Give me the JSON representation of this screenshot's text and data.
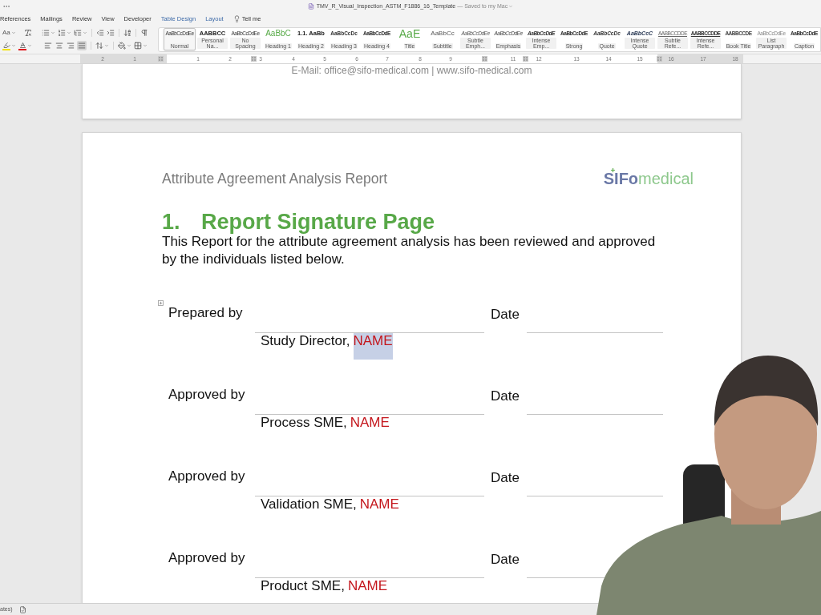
{
  "title_bar": {
    "title": "TMV_R_Visual_Inspection_ASTM_F1886_16_Template",
    "save_status": "— Saved to my Mac"
  },
  "menu": {
    "tabs": [
      {
        "label": "References",
        "kind": "standard"
      },
      {
        "label": "Mailings",
        "kind": "standard"
      },
      {
        "label": "Review",
        "kind": "standard"
      },
      {
        "label": "View",
        "kind": "standard"
      },
      {
        "label": "Developer",
        "kind": "standard"
      },
      {
        "label": "Table Design",
        "kind": "contextual"
      },
      {
        "label": "Layout",
        "kind": "contextual"
      }
    ],
    "tell_me": "Tell me"
  },
  "ribbon": {
    "change_case": "Aa",
    "alignment": [
      {
        "kind": "left",
        "selected": false
      },
      {
        "kind": "center",
        "selected": false
      },
      {
        "kind": "right",
        "selected": false
      },
      {
        "kind": "justify",
        "selected": true
      }
    ],
    "styles": [
      {
        "preview": "AaBbCcDdEe",
        "label": "Normal",
        "kind": "normal",
        "selected": true
      },
      {
        "preview": "AABBCC",
        "label": "Personal Na...",
        "kind": "personal",
        "selected": false
      },
      {
        "preview": "AaBbCcDdEe",
        "label": "No Spacing",
        "kind": "nospacing",
        "selected": false
      },
      {
        "preview": "AaBbC",
        "label": "Heading 1",
        "kind": "heading1",
        "selected": false
      },
      {
        "preview": "1.1. AaBb",
        "label": "Heading 2",
        "kind": "heading2",
        "selected": false
      },
      {
        "preview": "AaBbCcDc",
        "label": "Heading 3",
        "kind": "heading3",
        "selected": false
      },
      {
        "preview": "AaBbCcDdE",
        "label": "Heading 4",
        "kind": "heading4",
        "selected": false
      },
      {
        "preview": "AaE",
        "label": "Title",
        "kind": "title",
        "selected": false
      },
      {
        "preview": "AaBbCc",
        "label": "Subtitle",
        "kind": "subtitle",
        "selected": false
      },
      {
        "preview": "AaBbCcDdEe",
        "label": "Subtle Emph...",
        "kind": "subtleemphasis",
        "selected": false
      },
      {
        "preview": "AaBbCcDdEe",
        "label": "Emphasis",
        "kind": "emphasis",
        "selected": false
      },
      {
        "preview": "AaBbCcDdE",
        "label": "Intense Emp...",
        "kind": "intenseemphasis",
        "selected": false
      },
      {
        "preview": "AaBbCcDdE",
        "label": "Strong",
        "kind": "strong",
        "selected": false
      },
      {
        "preview": "AaBbCcDc",
        "label": "Quote",
        "kind": "quote",
        "selected": false
      },
      {
        "preview": "AaBbCcC",
        "label": "Intense Quote",
        "kind": "intensequote",
        "selected": false
      },
      {
        "preview": "AABBCCDDE",
        "label": "Subtle Refe...",
        "kind": "subtlereference",
        "selected": false
      },
      {
        "preview": "AABBCCDDE",
        "label": "Intense Refe...",
        "kind": "intensereference",
        "selected": false
      },
      {
        "preview": "AABBCCDE",
        "label": "Book Title",
        "kind": "booktitle",
        "selected": false
      },
      {
        "preview": "AaBbCcDdEe",
        "label": "List Paragraph",
        "kind": "listparagraph",
        "selected": false
      },
      {
        "preview": "AaBbCcDdE",
        "label": "Caption",
        "kind": "caption",
        "selected": false
      }
    ]
  },
  "ruler": {
    "labels": [
      "2",
      "1",
      "1",
      "2",
      "3",
      "4",
      "5",
      "6",
      "7",
      "8",
      "9",
      "11",
      "12",
      "13",
      "14",
      "15",
      "16",
      "17",
      "18"
    ]
  },
  "document": {
    "previous_page_footer": "E-Mail: office@sifo-medical.com | www.sifo-medical.com",
    "header_title": "Attribute Agreement Analysis Report",
    "logo": {
      "primary": "SIFo",
      "secondary": "medical"
    },
    "heading": {
      "number": "1.",
      "text": "Report Signature Page"
    },
    "intro": "This Report for the attribute agreement analysis has been reviewed and approved by the individuals listed below.",
    "signatures": [
      {
        "label": "Prepared by",
        "date_label": "Date",
        "role": "Study Director,",
        "name": "NAME",
        "name_selected": true
      },
      {
        "label": "Approved by",
        "date_label": "Date",
        "role": "Process SME,",
        "name": "NAME",
        "name_selected": false
      },
      {
        "label": "Approved by",
        "date_label": "Date",
        "role": "Validation SME,",
        "name": "NAME",
        "name_selected": false
      },
      {
        "label": "Approved by",
        "date_label": "Date",
        "role": "Product SME,",
        "name": "NAME",
        "name_selected": false
      }
    ]
  },
  "status_bar": {
    "text": "ates)"
  }
}
